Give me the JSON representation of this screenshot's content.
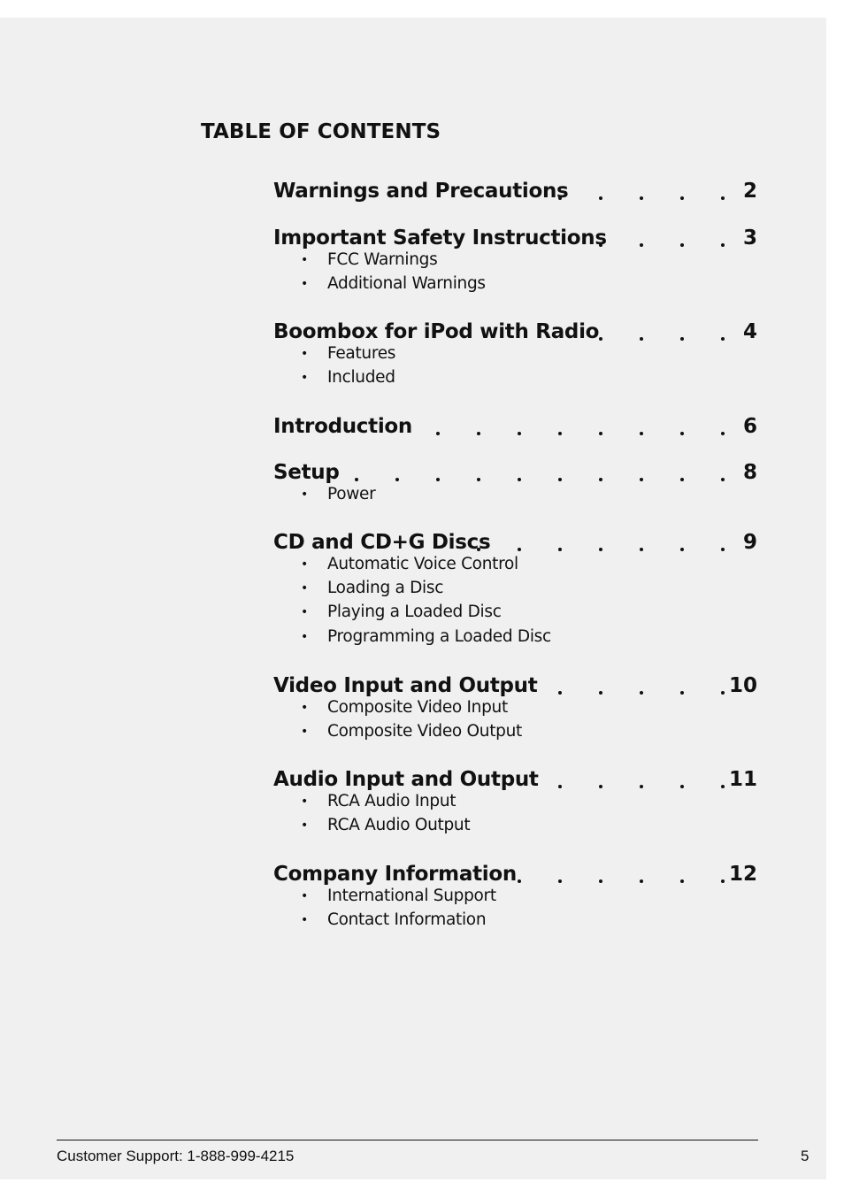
{
  "title": "TABLE OF CONTENTS",
  "entries": [
    {
      "title": "Warnings and Precautions",
      "page": "2",
      "dots": [
        5,
        6,
        7,
        8,
        9
      ],
      "subs": []
    },
    {
      "title": "Important Safety Instructions",
      "page": "3",
      "dots": [
        6,
        7,
        8,
        9
      ],
      "subs": [
        "FCC Warnings",
        "Additional Warnings"
      ]
    },
    {
      "title": "Boombox for iPod with Radio",
      "page": "4",
      "dots": [
        6,
        7,
        8,
        9
      ],
      "subs": [
        "Features",
        "Included"
      ]
    },
    {
      "title": "Introduction",
      "page": "6",
      "dots": [
        2,
        3,
        4,
        5,
        6,
        7,
        8,
        9
      ],
      "subs": []
    },
    {
      "title": "Setup",
      "page": "8",
      "dots": [
        0,
        1,
        2,
        3,
        4,
        5,
        6,
        7,
        8,
        9
      ],
      "subs": [
        "Power"
      ]
    },
    {
      "title": "CD and CD+G Discs",
      "page": "9",
      "dots": [
        3,
        4,
        5,
        6,
        7,
        8,
        9
      ],
      "subs": [
        "Automatic Voice Control",
        "Loading a Disc",
        "Playing a Loaded Disc",
        "Programming a Loaded Disc"
      ]
    },
    {
      "title": "Video Input and Output",
      "page": "10",
      "dots": [
        5,
        6,
        7,
        8,
        9
      ],
      "subs": [
        "Composite Video Input",
        "Composite Video Output"
      ]
    },
    {
      "title": "Audio Input and Output",
      "page": "11",
      "dots": [
        5,
        6,
        7,
        8,
        9
      ],
      "subs": [
        "RCA Audio Input",
        "RCA Audio Output"
      ]
    },
    {
      "title": "Company Information",
      "page": "12",
      "dots": [
        4,
        5,
        6,
        7,
        8,
        9
      ],
      "subs": [
        "International Support",
        "Contact Information"
      ]
    }
  ],
  "footer": {
    "support": "Customer Support: 1-888-999-4215",
    "page_number": "5"
  }
}
